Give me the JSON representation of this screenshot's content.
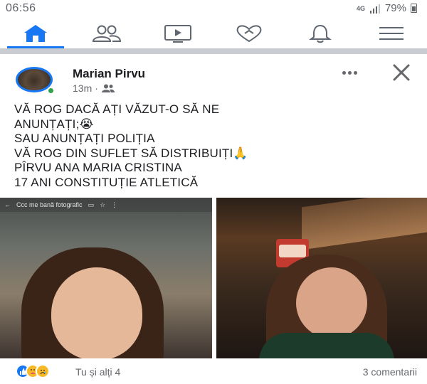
{
  "status_bar": {
    "time": "06:56",
    "network": "4G",
    "battery": "79%"
  },
  "nav": {
    "tabs": [
      {
        "icon": "home-icon",
        "active": true
      },
      {
        "icon": "friends-icon",
        "active": false
      },
      {
        "icon": "watch-icon",
        "active": false
      },
      {
        "icon": "dating-heart-icon",
        "active": false
      },
      {
        "icon": "notifications-bell-icon",
        "active": false
      },
      {
        "icon": "menu-icon",
        "active": false
      }
    ],
    "accent_color": "#1877f2"
  },
  "post": {
    "author": "Marian Pirvu",
    "time_ago": "13m",
    "separator": "·",
    "audience_icon": "friends-audience-icon",
    "lines": [
      "VĂ ROG DACĂ AȚI VĂZUT-O SĂ NE",
      "ANUNȚAȚI;😭",
      "SAU ANUNȚAȚI POLIȚIA",
      "VĂ ROG DIN SUFLET SĂ DISTRIBUIȚI🙏",
      "PÎRVU ANA MARIA CRISTINA",
      "17 ANI CONSTITUȚIE ATLETICĂ"
    ],
    "photo_left_overlay": "Ccc me bană fotografic",
    "reactions": [
      "like",
      "care",
      "sad"
    ],
    "reactors_text": "Tu și alți 4",
    "comments_text": "3 comentarii"
  }
}
